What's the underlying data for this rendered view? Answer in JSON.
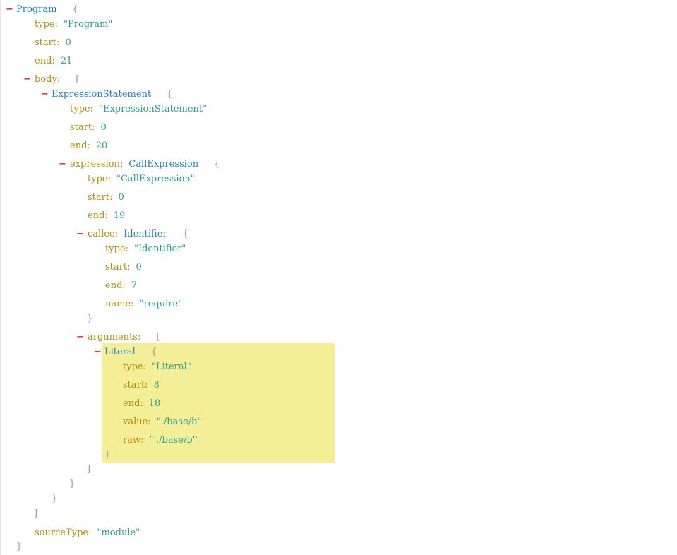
{
  "tree": {
    "program": {
      "label": "Program",
      "type": "\"Program\"",
      "start": "0",
      "end": "21",
      "body_key": "body:",
      "source_type_key": "sourceType:",
      "source_type": "\"module\""
    },
    "expression_statement": {
      "label": "ExpressionStatement",
      "type": "\"ExpressionStatement\"",
      "start": "0",
      "end": "20",
      "expression_key": "expression:"
    },
    "call_expression": {
      "label": "CallExpression",
      "type": "\"CallExpression\"",
      "start": "0",
      "end": "19",
      "callee_key": "callee:",
      "arguments_key": "arguments:"
    },
    "identifier": {
      "label": "Identifier",
      "type": "\"Identifier\"",
      "start": "0",
      "end": "7",
      "name": "\"require\""
    },
    "literal": {
      "label": "Literal",
      "type": "\"Literal\"",
      "start": "8",
      "end": "18",
      "value": "\"./base/b\"",
      "raw": "\"'./base/b'\""
    }
  },
  "keys": {
    "type": "type:",
    "start": "start:",
    "end": "end:",
    "name": "name:",
    "value": "value:",
    "raw": "raw:"
  },
  "glyphs": {
    "collapse": "−",
    "brace_open": "{",
    "brace_close": "}",
    "bracket_open": "[",
    "bracket_close": "]"
  },
  "colors": {
    "key": "#b58a08",
    "string": "#2a9d8f",
    "node": "#1e7fc8",
    "toggle": "#e8262a",
    "highlight": "#f4ee96"
  }
}
